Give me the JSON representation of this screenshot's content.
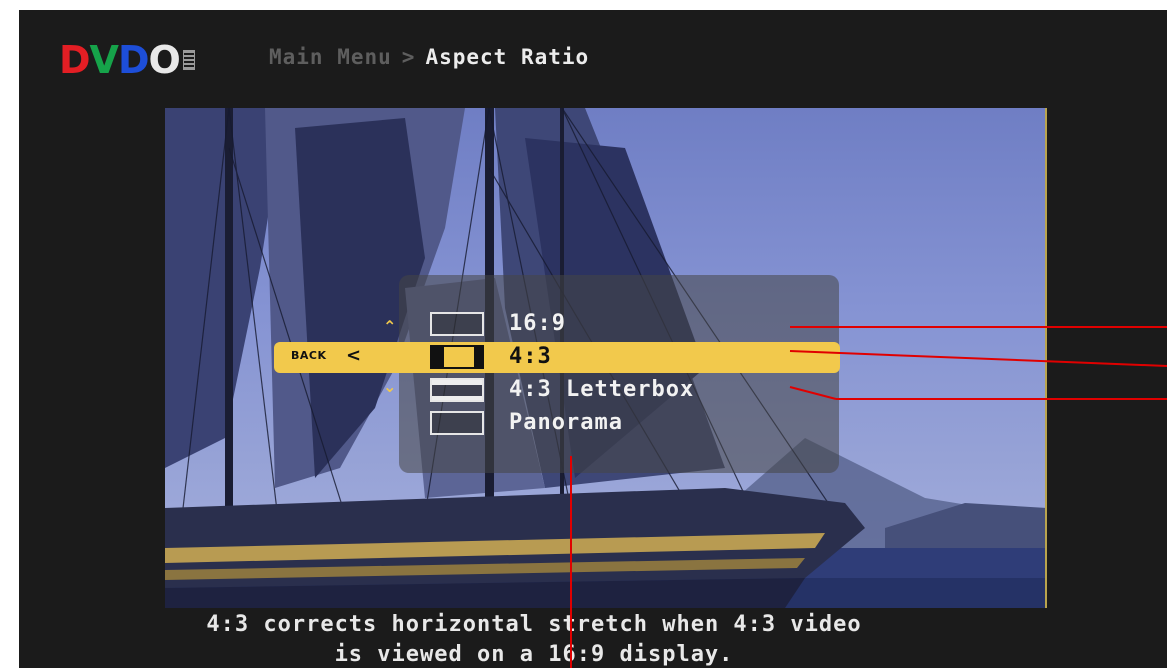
{
  "header": {
    "logo": {
      "d": "D",
      "v": "V",
      "d2": "D",
      "o": "O"
    },
    "breadcrumb": {
      "parent": "Main Menu",
      "separator": ">",
      "current": "Aspect Ratio"
    }
  },
  "menu": {
    "back_label": "BACK",
    "back_icon": "chevron-left-icon",
    "options": [
      {
        "label": "16:9",
        "selected": false
      },
      {
        "label": "4:3",
        "selected": true
      },
      {
        "label": "4:3 Letterbox",
        "selected": false
      },
      {
        "label": "Panorama",
        "selected": false
      }
    ]
  },
  "caption": {
    "line1": "4:3 corrects horizontal stretch when 4:3 video",
    "line2": "is viewed on a 16:9 display."
  },
  "colors": {
    "background": "#1b1b1b",
    "accent": "#f2c94c",
    "callout": "#e00000",
    "logo_red": "#e31e24",
    "logo_green": "#16a34a",
    "logo_blue": "#1d4ed8"
  }
}
